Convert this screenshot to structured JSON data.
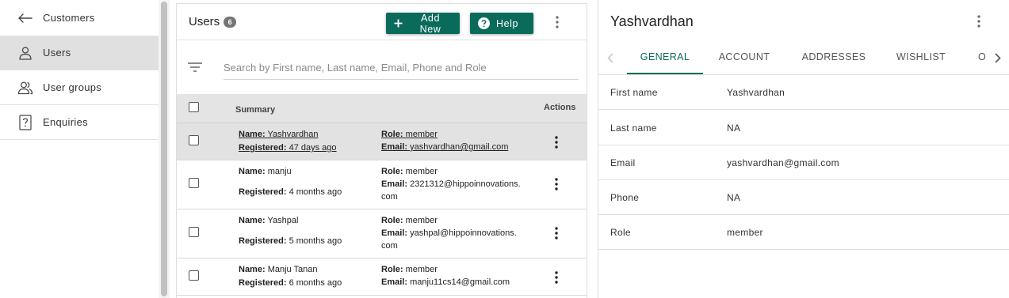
{
  "sidebar": {
    "back_label": "Customers",
    "items": [
      {
        "label": "Users",
        "icon": "person-icon",
        "active": true
      },
      {
        "label": "User groups",
        "icon": "people-icon",
        "active": false
      },
      {
        "label": "Enquiries",
        "icon": "question-box-icon",
        "active": false
      }
    ]
  },
  "users_panel": {
    "title": "Users",
    "count": "6",
    "add_button": "Add New",
    "help_button": "Help",
    "search_placeholder": "Search by First name, Last name, Email, Phone and Role",
    "columns": {
      "summary": "Summary",
      "actions": "Actions"
    },
    "labels": {
      "name": "Name:",
      "registered": "Registered:",
      "role": "Role:",
      "email": "Email:"
    },
    "rows": [
      {
        "name": "Yashvardhan",
        "registered": "47 days ago",
        "role": "member",
        "email": "yashvardhan@gmail.com",
        "selected": true
      },
      {
        "name": "manju",
        "registered": "4 months ago",
        "role": "member",
        "email": "2321312@hippoinnovations.\ncom",
        "selected": false
      },
      {
        "name": "Yashpal",
        "registered": "5 months ago",
        "role": "member",
        "email": "yashpal@hippoinnovations.\ncom",
        "selected": false
      },
      {
        "name": "Manju Tanan",
        "registered": "6 months ago",
        "role": "member",
        "email": "manju11cs14@gmail.com",
        "selected": false
      }
    ]
  },
  "detail": {
    "title": "Yashvardhan",
    "tabs": [
      "GENERAL",
      "ACCOUNT",
      "ADDRESSES",
      "WISHLIST",
      "O"
    ],
    "active_tab": "GENERAL",
    "fields": [
      {
        "label": "First name",
        "value": "Yashvardhan"
      },
      {
        "label": "Last name",
        "value": "NA"
      },
      {
        "label": "Email",
        "value": "yashvardhan@gmail.com"
      },
      {
        "label": "Phone",
        "value": "NA"
      },
      {
        "label": "Role",
        "value": "member"
      }
    ]
  },
  "colors": {
    "primary": "#0b6b5b",
    "selected_row": "#e2e2e2",
    "header_bg": "#e4e4e4"
  }
}
